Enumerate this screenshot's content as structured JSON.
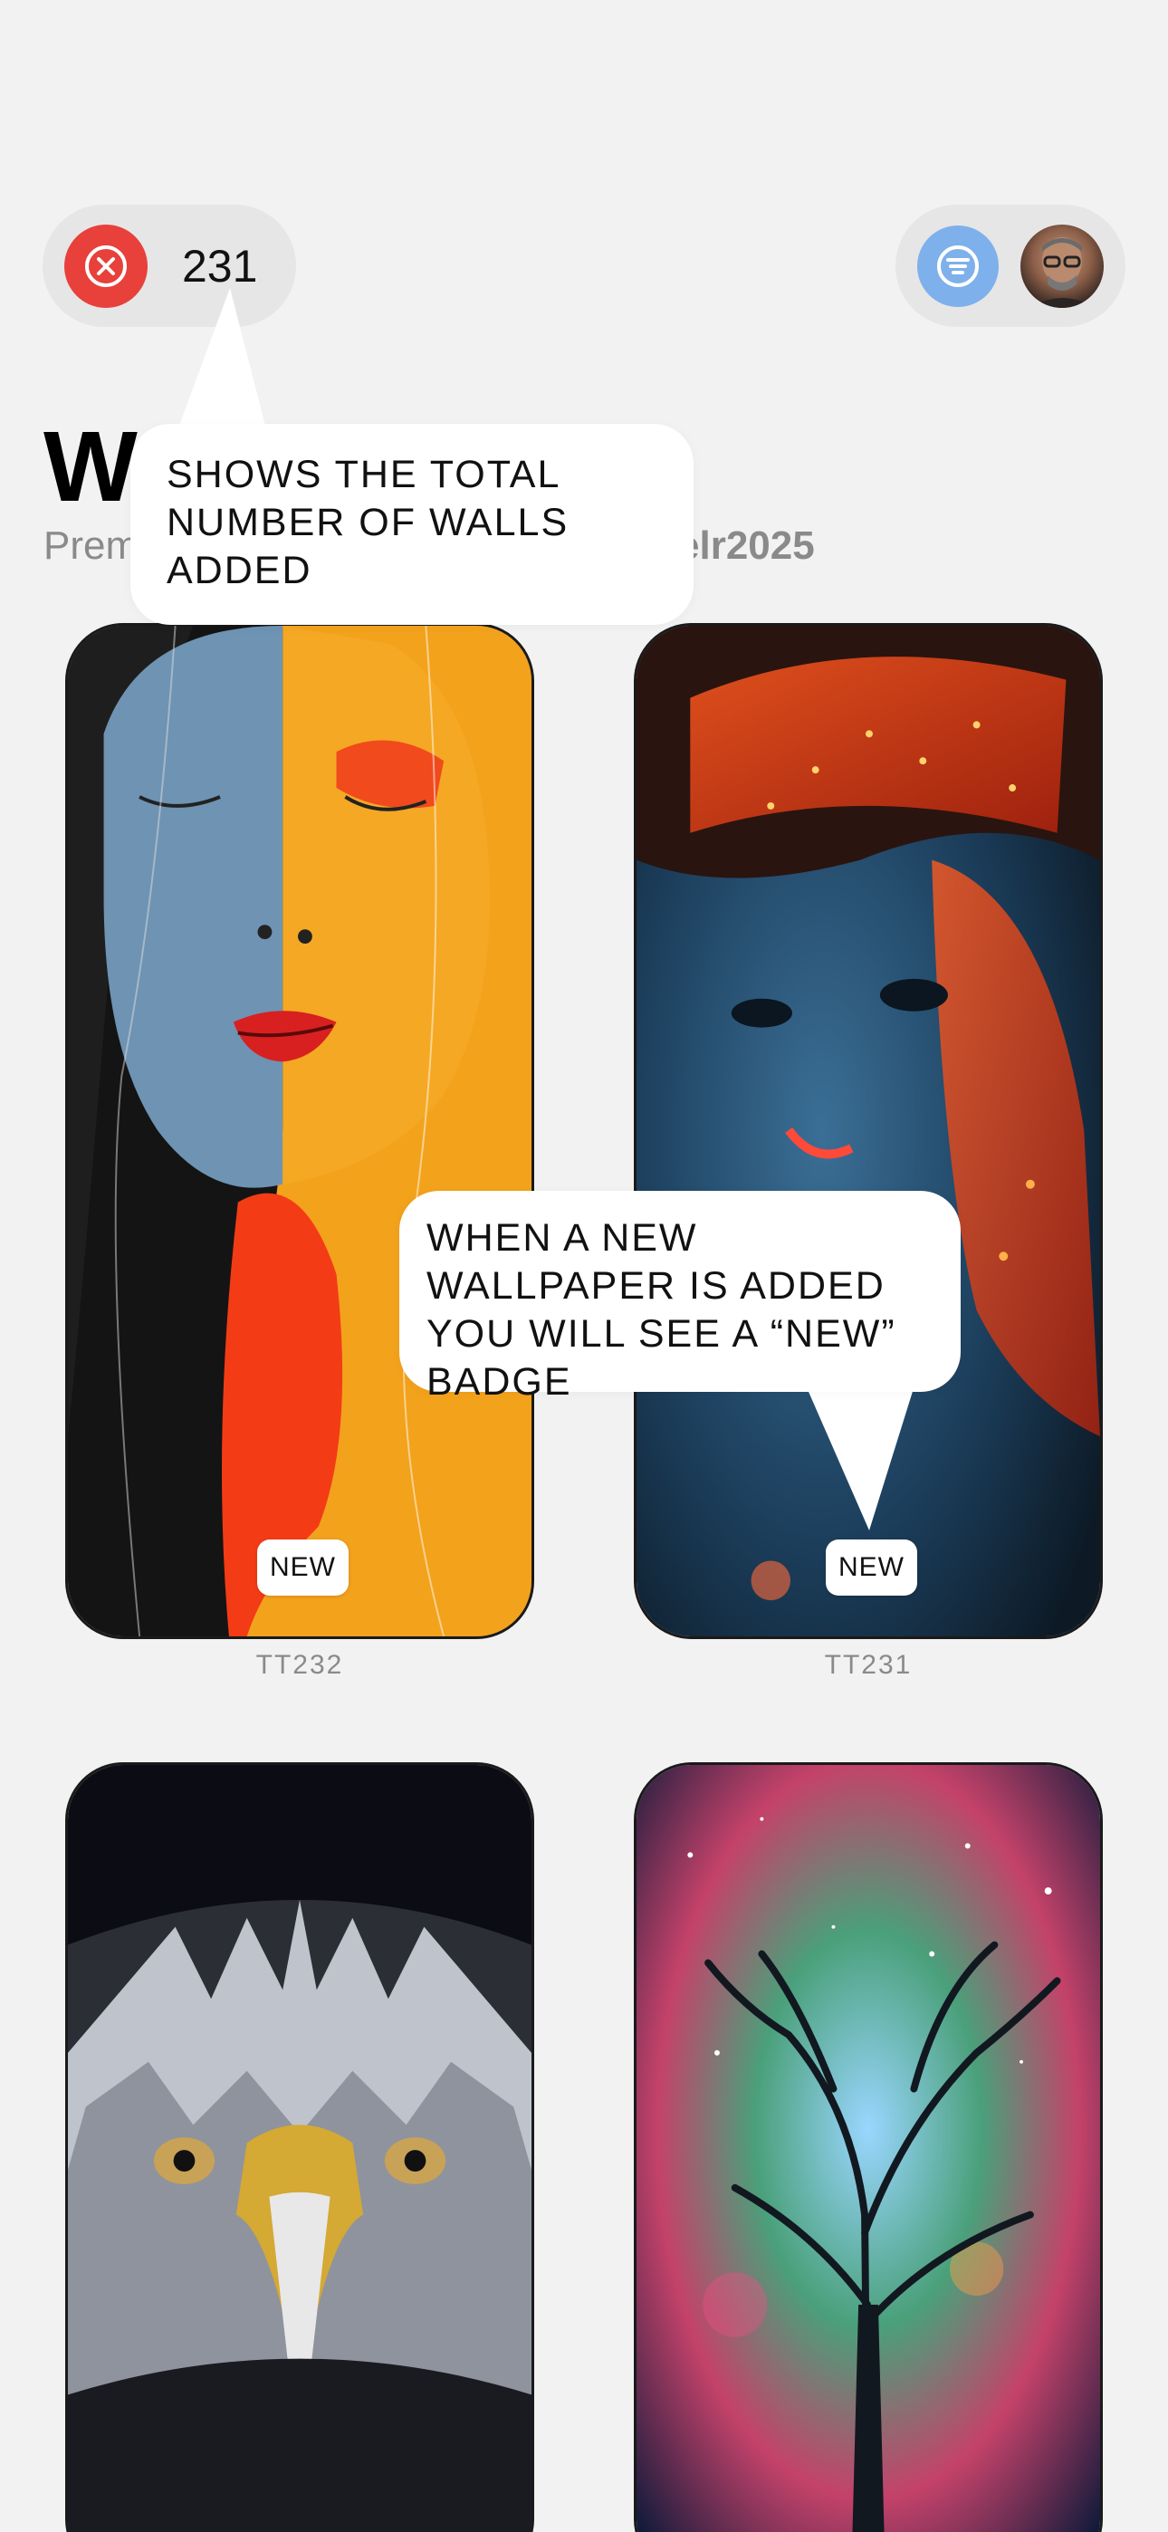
{
  "header": {
    "wall_count": "231",
    "close_icon": "circle-x-icon",
    "filter_icon": "filter-lines-icon",
    "avatar_icon": "user-avatar",
    "close_color": "#e8403a",
    "filter_color": "#7eb0ec"
  },
  "page": {
    "title": "W",
    "subtitle_left": "Prem",
    "subtitle_right": "elr2025"
  },
  "tooltips": {
    "count_tip": "SHOWS THE TOTAL NUMBER OF WALLS ADDED",
    "badge_tip": "WHEN A NEW WALLPAPER IS ADDED YOU WILL SEE A “NEW” BADGE"
  },
  "wallpapers": [
    {
      "code": "TT232",
      "badge": "NEW",
      "image": "split-color-face-painting"
    },
    {
      "code": "TT231",
      "badge": "NEW",
      "image": "neon-circuit-face"
    },
    {
      "code": "",
      "badge": "",
      "image": "eagle-head-3d"
    },
    {
      "code": "",
      "badge": "",
      "image": "cosmic-tree-nebula"
    }
  ]
}
